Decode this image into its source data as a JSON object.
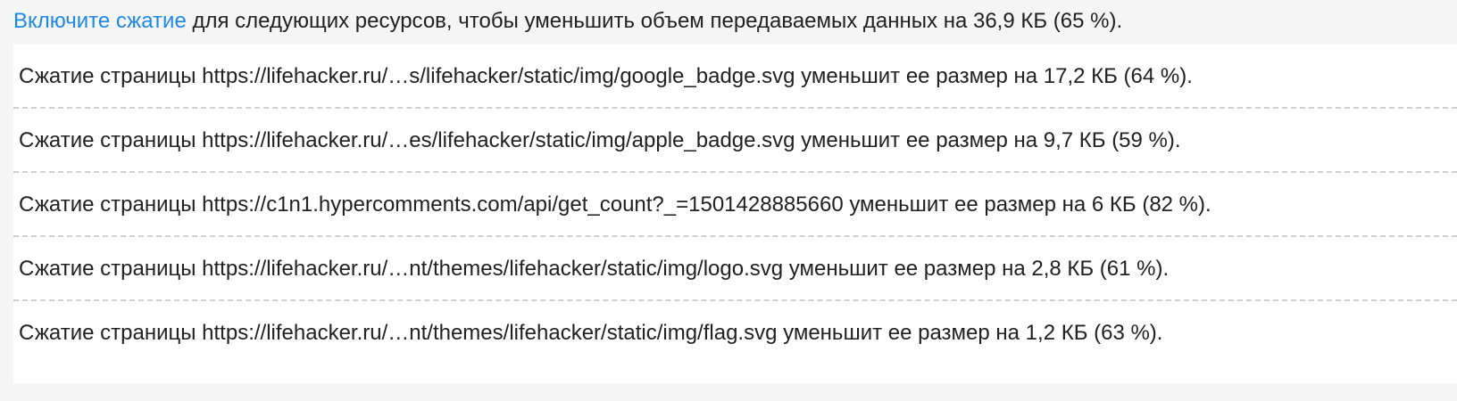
{
  "summary": {
    "link_text": "Включите сжатие",
    "rest_text": " для следующих ресурсов, чтобы уменьшить объем передаваемых данных на 36,9 КБ (65 %)."
  },
  "resources": [
    "Сжатие страницы https://lifehacker.ru/…s/lifehacker/static/img/google_badge.svg уменьшит ее размер на 17,2 КБ (64 %).",
    "Сжатие страницы https://lifehacker.ru/…es/lifehacker/static/img/apple_badge.svg уменьшит ее размер на 9,7 КБ (59 %).",
    "Сжатие страницы https://c1n1.hypercomments.com/api/get_count?_=1501428885660 уменьшит ее размер на 6 КБ (82 %).",
    "Сжатие страницы https://lifehacker.ru/…nt/themes/lifehacker/static/img/logo.svg уменьшит ее размер на 2,8 КБ (61 %).",
    "Сжатие страницы https://lifehacker.ru/…nt/themes/lifehacker/static/img/flag.svg уменьшит ее размер на 1,2 КБ (63 %)."
  ]
}
